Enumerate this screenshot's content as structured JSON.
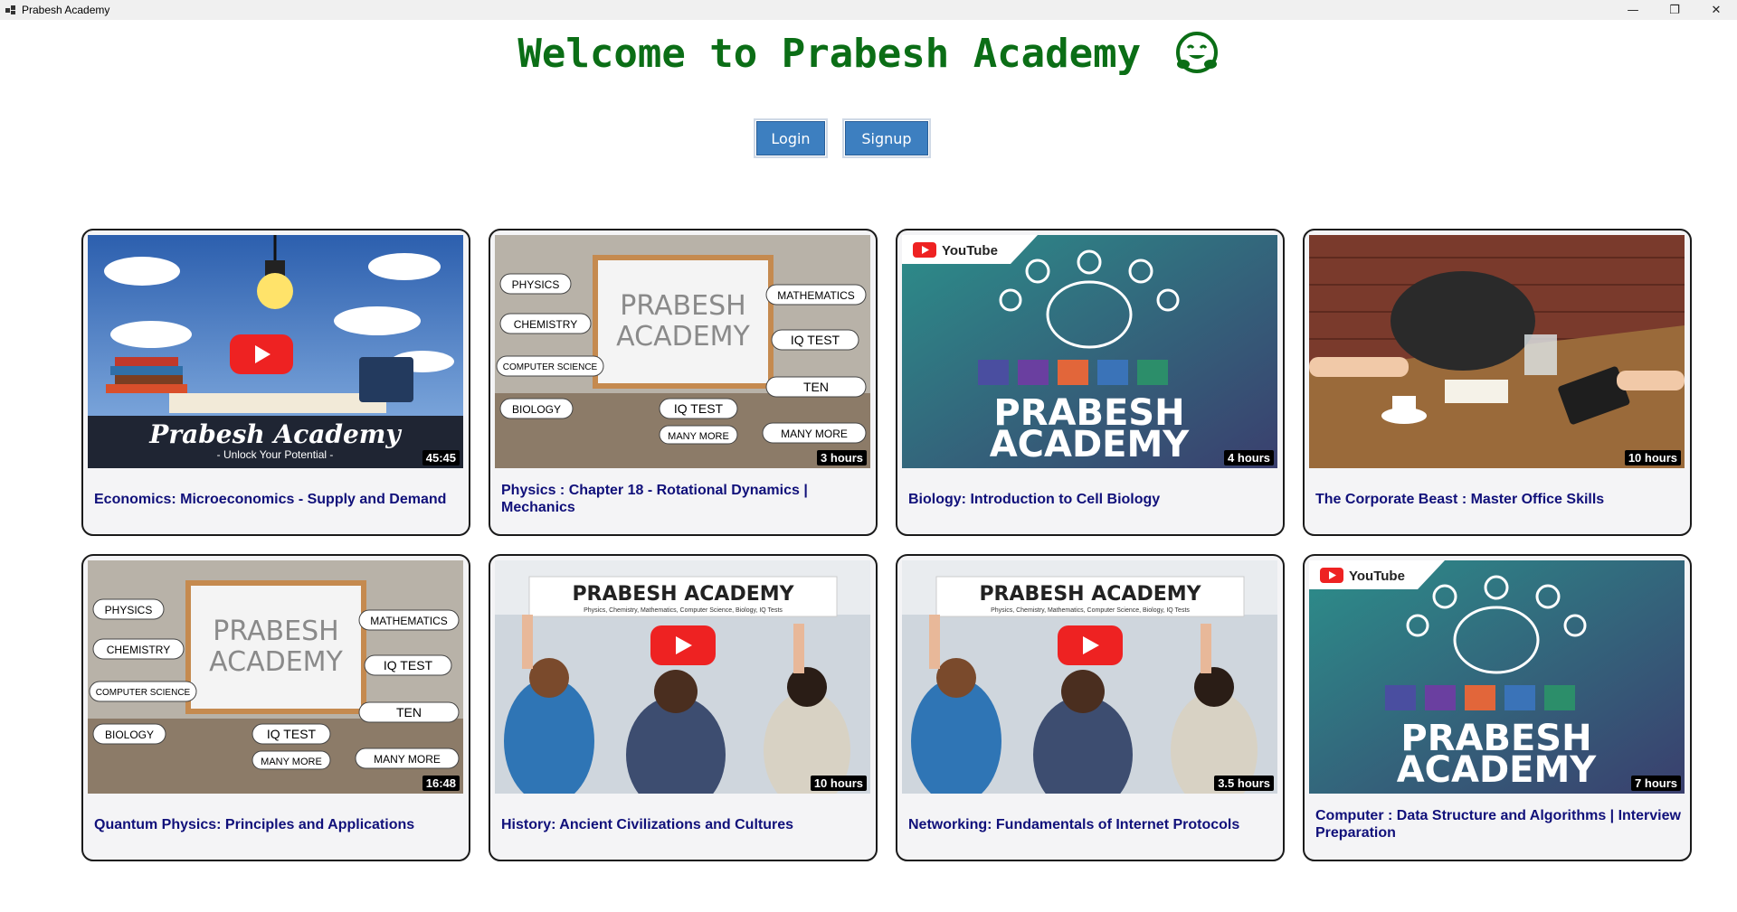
{
  "window": {
    "title": "Prabesh Academy",
    "controls": {
      "minimize": "—",
      "maximize": "❐",
      "close": "✕"
    }
  },
  "header": {
    "welcome": "Welcome to Prabesh Academy",
    "emoji_icon": "hugging-face-icon",
    "color": "#0b6e16"
  },
  "auth": {
    "login_label": "Login",
    "signup_label": "Signup",
    "button_color": "#3d7fc0"
  },
  "courses": [
    {
      "title": "Economics: Microeconomics - Supply and Demand",
      "duration": "45:45",
      "thumbnail": "lightbulb-books"
    },
    {
      "title": "Physics : Chapter 18 - Rotational Dynamics | Mechanics",
      "duration": "3 hours",
      "thumbnail": "whiteboard"
    },
    {
      "title": "Biology: Introduction to Cell Biology",
      "duration": "4 hours",
      "thumbnail": "brain-youtube"
    },
    {
      "title": "The Corporate Beast : Master Office Skills",
      "duration": "10 hours",
      "thumbnail": "office-table"
    },
    {
      "title": "Quantum Physics: Principles and Applications",
      "duration": "16:48",
      "thumbnail": "whiteboard"
    },
    {
      "title": "History: Ancient Civilizations and Cultures",
      "duration": "10 hours",
      "thumbnail": "classroom"
    },
    {
      "title": "Networking: Fundamentals of Internet Protocols",
      "duration": "3.5 hours",
      "thumbnail": "classroom"
    },
    {
      "title": "Computer : Data Structure and Algorithms | Interview Preparation",
      "duration": "7 hours",
      "thumbnail": "brain-youtube"
    }
  ],
  "thumb_text": {
    "brand_script": "Prabesh Academy",
    "brand_tagline": "- Unlock Your Potential -",
    "brand_block_1": "PRABESH",
    "brand_block_2": "ACADEMY",
    "youtube": "YouTube",
    "banner_title": "PRABESH ACADEMY",
    "banner_sub": "Physics, Chemistry, Mathematics, Computer Science, Biology, IQ Tests",
    "wb_left": [
      "PHYSICS",
      "CHEMISTRY",
      "COMPUTER SCIENCE",
      "BIOLOGY"
    ],
    "wb_right": [
      "MATHEMATICS",
      "IQ TEST",
      "TEN",
      "MANY MORE"
    ],
    "wb_bottom": [
      "IQ TEST",
      "MANY MORE"
    ]
  }
}
